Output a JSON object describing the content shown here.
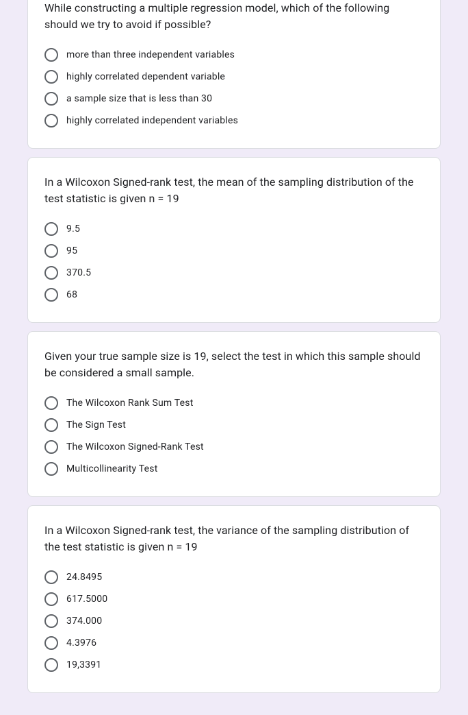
{
  "questions": [
    {
      "prompt": "While constructing a multiple regression model, which of the following should we try to avoid if possible?",
      "options": [
        "more than three independent variables",
        "highly correlated dependent variable",
        "a sample size that is less than 30",
        "highly correlated independent variables"
      ]
    },
    {
      "prompt": "In a Wilcoxon Signed-rank test, the mean of the sampling distribution of the test statistic is given n = 19",
      "options": [
        "9.5",
        "95",
        "370.5",
        "68"
      ]
    },
    {
      "prompt": "Given your true sample size is 19, select the test in which this sample should be considered a small sample.",
      "options": [
        "The Wilcoxon Rank Sum Test",
        "The Sign Test",
        "The Wilcoxon Signed-Rank Test",
        "Multicollinearity Test"
      ]
    },
    {
      "prompt": "In a Wilcoxon Signed-rank test, the variance of the sampling distribution of the test statistic is given n = 19",
      "options": [
        "24.8495",
        "617.5000",
        "374.000",
        "4.3976",
        "19,3391"
      ]
    }
  ]
}
